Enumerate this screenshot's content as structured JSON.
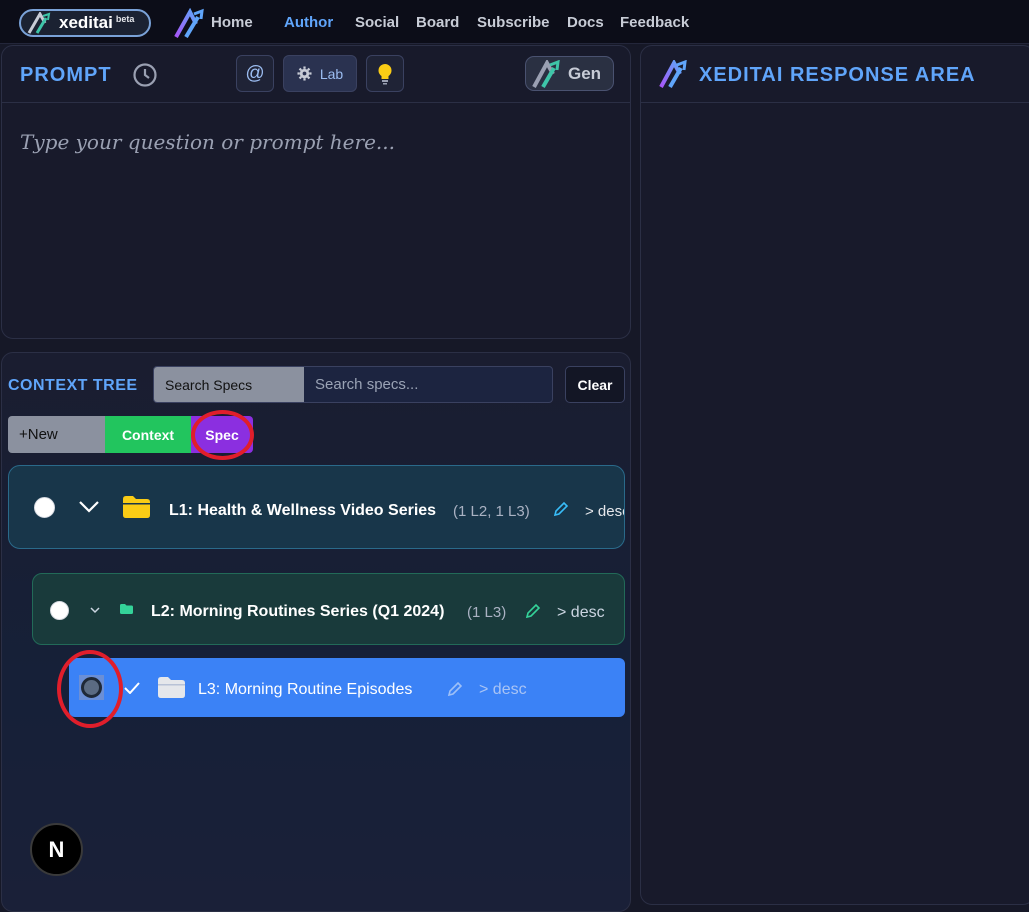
{
  "nav": {
    "brand": "xeditai",
    "beta": "beta",
    "links": [
      "Home",
      "Author",
      "Social",
      "Board",
      "Subscribe",
      "Docs",
      "Feedback"
    ]
  },
  "prompt": {
    "title": "PROMPT",
    "at_label": "@",
    "lab_label": "Lab",
    "gen_label": "Gen",
    "placeholder": "Type your question or prompt here..."
  },
  "response": {
    "title": "XEDITAI RESPONSE AREA"
  },
  "context": {
    "title": "CONTEXT TREE",
    "search_tag": "Search Specs",
    "search_placeholder": "Search specs...",
    "clear_label": "Clear",
    "new_label": "+New",
    "context_label": "Context",
    "spec_label": "Spec",
    "nodes": [
      {
        "label": "L1: Health & Wellness Video Series",
        "count": "(1 L2, 1 L3)",
        "desc": "> desc"
      },
      {
        "label": "L2: Morning Routines Series (Q1 2024)",
        "count": "(1 L3)",
        "desc": "> desc"
      },
      {
        "label": "L3: Morning Routine Episodes",
        "count": "",
        "desc": "> desc"
      }
    ]
  },
  "badge": "N",
  "colors": {
    "accent": "#60a5fa",
    "annotation_ring": "#e01e2b",
    "selected_node": "#3b82f6",
    "spec_purple": "#8b2fe0",
    "context_green": "#22c55e"
  }
}
